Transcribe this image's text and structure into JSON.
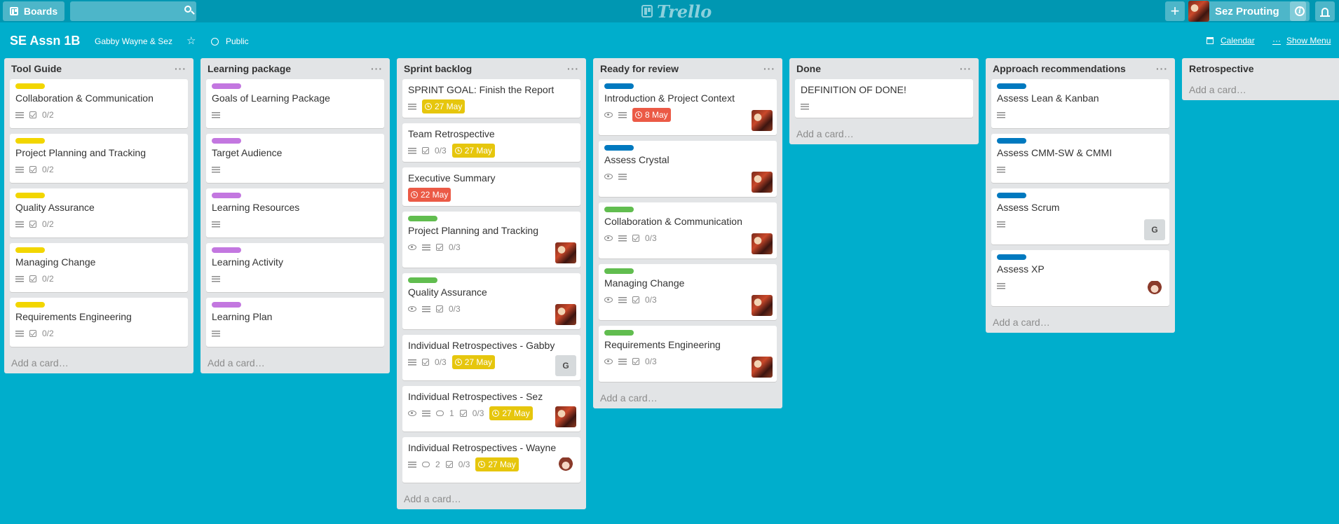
{
  "header": {
    "boards_label": "Boards",
    "search_placeholder": "",
    "logo_text": "Trello",
    "user_name": "Sez Prouting"
  },
  "board": {
    "title": "SE Assn 1B",
    "team": "Gabby Wayne & Sez",
    "visibility": "Public",
    "calendar_label": "Calendar",
    "show_menu_label": "Show Menu",
    "add_card_label": "Add a card…"
  },
  "colors": {
    "yellow": "#f2d600",
    "purple": "#c377e0",
    "green": "#61bd4f",
    "blue": "#0079bf",
    "due_yellow": "#e6c60d",
    "due_red": "#eb5a46"
  },
  "lists": [
    {
      "title": "Tool Guide",
      "cards": [
        {
          "title": "Collaboration & Communication",
          "checklist": "0/2"
        },
        {
          "title": "Project Planning and Tracking",
          "checklist": "0/2"
        },
        {
          "title": "Quality Assurance",
          "checklist": "0/2"
        },
        {
          "title": "Managing Change",
          "checklist": "0/2"
        },
        {
          "title": "Requirements Engineering",
          "checklist": "0/2"
        }
      ]
    },
    {
      "title": "Learning package",
      "cards": [
        {
          "title": "Goals of Learning Package"
        },
        {
          "title": "Target Audience"
        },
        {
          "title": "Learning Resources"
        },
        {
          "title": "Learning Activity"
        },
        {
          "title": "Learning Plan"
        }
      ]
    },
    {
      "title": "Sprint backlog",
      "cards": [
        {
          "title": "SPRINT GOAL: Finish the Report",
          "due": "27 May"
        },
        {
          "title": "Team Retrospective",
          "checklist": "0/3",
          "due": "27 May"
        },
        {
          "title": "Executive Summary",
          "due": "22 May"
        },
        {
          "title": "Project Planning and Tracking",
          "checklist": "0/3"
        },
        {
          "title": "Quality Assurance",
          "checklist": "0/3"
        },
        {
          "title": "Individual Retrospectives - Gabby",
          "checklist": "0/3",
          "due": "27 May",
          "member": "G"
        },
        {
          "title": "Individual Retrospectives - Sez",
          "comments": "1",
          "checklist": "0/3",
          "due": "27 May"
        },
        {
          "title": "Individual Retrospectives - Wayne",
          "comments": "2",
          "checklist": "0/3",
          "due": "27 May"
        }
      ]
    },
    {
      "title": "Ready for review",
      "cards": [
        {
          "title": "Introduction & Project Context",
          "due": "8 May"
        },
        {
          "title": "Assess Crystal"
        },
        {
          "title": "Collaboration & Communication",
          "checklist": "0/3"
        },
        {
          "title": "Managing Change",
          "checklist": "0/3"
        },
        {
          "title": "Requirements Engineering",
          "checklist": "0/3"
        }
      ]
    },
    {
      "title": "Done",
      "cards": [
        {
          "title": "DEFINITION OF DONE!"
        }
      ]
    },
    {
      "title": "Approach recommendations",
      "cards": [
        {
          "title": "Assess Lean & Kanban"
        },
        {
          "title": "Assess CMM-SW & CMMI"
        },
        {
          "title": "Assess Scrum",
          "member": "G"
        },
        {
          "title": "Assess XP"
        }
      ]
    },
    {
      "title": "Retrospective",
      "cards": []
    }
  ]
}
